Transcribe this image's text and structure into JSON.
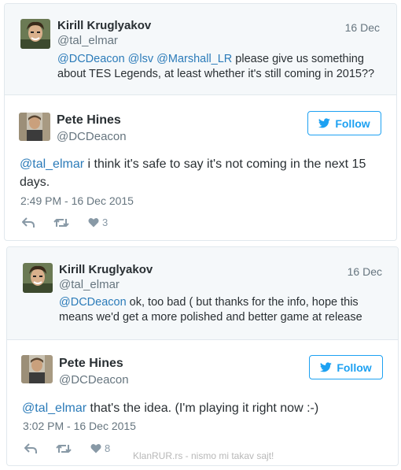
{
  "tweets": [
    {
      "quoted": {
        "name": "Kirill Kruglyakov",
        "handle": "@tal_elmar",
        "date": "16 Dec",
        "mentions": [
          "@DCDeacon",
          "@lsv",
          "@Marshall_LR"
        ],
        "text_line1_rest": " please give us something",
        "text_line2": "about TES Legends, at least whether it's still coming in 2015??"
      },
      "reply": {
        "name": "Pete Hines",
        "handle": "@DCDeacon",
        "follow_label": "Follow",
        "mention": "@tal_elmar",
        "text_rest": " i think it's safe to say it's not coming in the next 15",
        "text_line2": "days.",
        "timestamp": "2:49 PM - 16 Dec 2015",
        "like_count": "3"
      }
    },
    {
      "quoted": {
        "name": "Kirill Kruglyakov",
        "handle": "@tal_elmar",
        "date": "16 Dec",
        "mention": "@DCDeacon",
        "text_line1_rest": " ok, too bad ( but thanks for the info, hope this",
        "text_line2": "means we'd get a more polished and better game at release"
      },
      "reply": {
        "name": "Pete Hines",
        "handle": "@DCDeacon",
        "follow_label": "Follow",
        "mention": "@tal_elmar",
        "text_rest": " that's the idea. (I'm playing it right now :-)",
        "timestamp": "3:02 PM - 16 Dec 2015",
        "like_count": "8"
      }
    }
  ],
  "watermark": "KlanRUR.rs - nismo mi takav sajt!",
  "colors": {
    "link": "#2b7bb9",
    "twitter_blue": "#1da1f2",
    "muted": "#66757f",
    "border": "#e1e8ed",
    "quote_bg": "#f5f8fa"
  },
  "icons": [
    "reply-icon",
    "retweet-icon",
    "heart-icon",
    "twitter-bird-icon"
  ]
}
